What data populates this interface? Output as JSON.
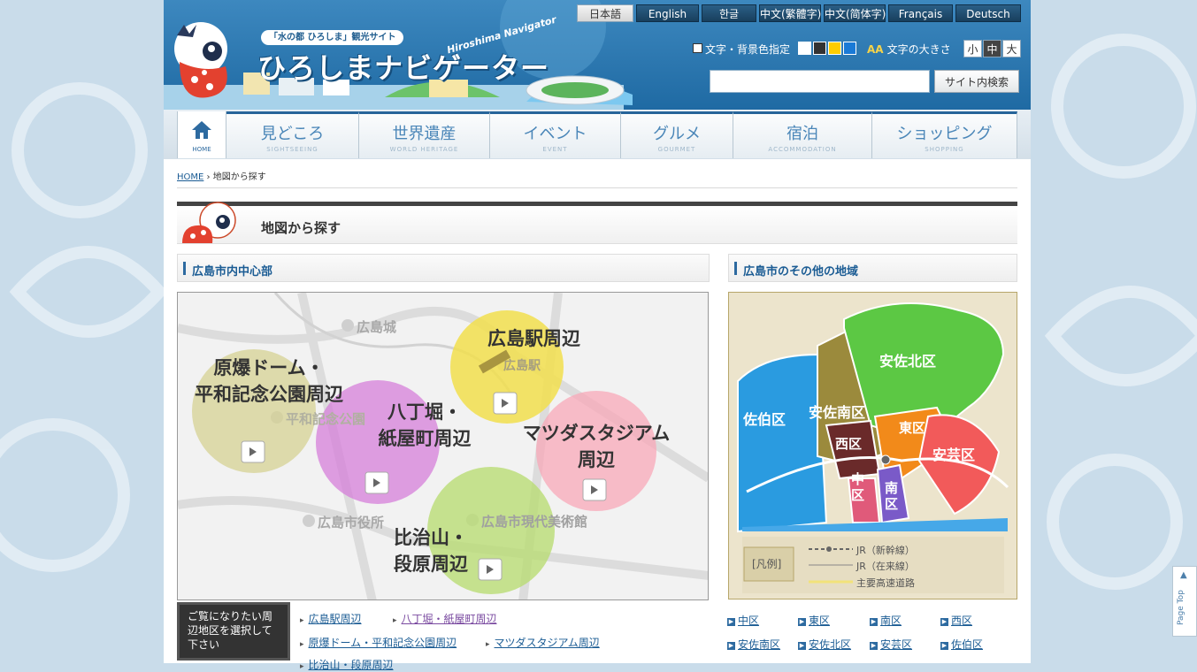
{
  "header": {
    "tagline": "「水の都 ひろしま」観光サイト",
    "logo_text": "ひろしまナビゲーター",
    "logo_en": "Hiroshima Navigator"
  },
  "languages": [
    {
      "label": "日本語",
      "active": true
    },
    {
      "label": "English",
      "active": false
    },
    {
      "label": "한글",
      "active": false
    },
    {
      "label": "中文(繁體字)",
      "active": false
    },
    {
      "label": "中文(简体字)",
      "active": false
    },
    {
      "label": "Français",
      "active": false
    },
    {
      "label": "Deutsch",
      "active": false
    }
  ],
  "tools": {
    "color_label": "文字・背景色指定",
    "color_swatches": [
      "#ffffff",
      "#333333",
      "#ffcc00",
      "#1a7ad6"
    ],
    "font_icon": "AA",
    "font_size_label": "文字の大きさ",
    "font_sizes": [
      "小",
      "中",
      "大"
    ]
  },
  "search": {
    "placeholder": "",
    "button": "サイト内検索"
  },
  "nav": {
    "home": "HOME",
    "items": [
      {
        "ja": "見どころ",
        "en": "SIGHTSEEING"
      },
      {
        "ja": "世界遺産",
        "en": "WORLD HERITAGE"
      },
      {
        "ja": "イベント",
        "en": "EVENT"
      },
      {
        "ja": "グルメ",
        "en": "GOURMET"
      },
      {
        "ja": "宿泊",
        "en": "ACCOMMODATION"
      },
      {
        "ja": "ショッピング",
        "en": "SHOPPING"
      }
    ]
  },
  "breadcrumb": {
    "home": "HOME",
    "current": "地図から探す"
  },
  "page_title": "地図から探す",
  "left_section": {
    "title": "広島市内中心部",
    "landmarks": [
      "広島城",
      "広島駅",
      "平和記念公園",
      "広島市役所",
      "広島市現代美術館"
    ],
    "areas": [
      {
        "line1": "広島駅周辺",
        "line2": ""
      },
      {
        "line1": "原爆ドーム・",
        "line2": "平和記念公園周辺"
      },
      {
        "line1": "八丁堀・",
        "line2": "紙屋町周辺"
      },
      {
        "line1": "マツダスタジアム",
        "line2": "周辺"
      },
      {
        "line1": "比治山・",
        "line2": "段原周辺"
      }
    ],
    "prompt": "ご覧になりたい周辺地区を選択して下さい",
    "links": [
      "広島駅周辺",
      "八丁堀・紙屋町周辺",
      "原爆ドーム・平和記念公園周辺",
      "マツダスタジアム周辺",
      "比治山・段原周辺"
    ]
  },
  "right_section": {
    "title": "広島市のその他の地域",
    "wards": [
      "安佐北区",
      "安佐南区",
      "佐伯区",
      "西区",
      "東区",
      "安芸区",
      "中区",
      "南区"
    ],
    "legend": {
      "title": "[凡例]",
      "items": [
        "JR（新幹線）",
        "JR（在来線）",
        "主要高速道路"
      ]
    },
    "ward_links": [
      "中区",
      "東区",
      "南区",
      "西区",
      "安佐南区",
      "安佐北区",
      "安芸区",
      "佐伯区"
    ]
  },
  "page_top": "Page Top"
}
